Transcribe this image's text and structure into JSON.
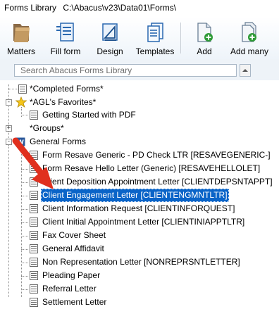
{
  "window": {
    "title": "Forms Library",
    "path": "C:\\Abacus\\v23\\Data01\\Forms\\"
  },
  "toolbar": {
    "matters": "Matters",
    "fill_form": "Fill form",
    "design": "Design",
    "templates": "Templates",
    "add": "Add",
    "add_many": "Add many"
  },
  "search": {
    "placeholder": "Search Abacus Forms Library"
  },
  "tree": {
    "completed_forms": "*Completed Forms*",
    "favorites": "*AGL's Favorites*",
    "getting_started": "Getting Started with PDF",
    "groups": "*Groups*",
    "general_forms": "General Forms",
    "items": [
      "Form Resave Generic - PD Check LTR [RESAVEGENERIC-]",
      "Form Resave Hello Letter (Generic) [RESAVEHELLOLET]",
      "Client Deposition Appointment Letter [CLIENTDEPSNTAPPT]",
      "Client Engagement Letter [CLIENTENGMNTLTR]",
      "Client Information Request [CLIENTINFORQUEST]",
      "Client Initial Appointment Letter [CLIENTINIAPPTLTR]",
      "Fax Cover Sheet",
      "General Affidavit",
      "Non Representation Letter [NONREPRSNTLETTER]",
      "Pleading Paper",
      "Referral Letter",
      "Settlement Letter"
    ],
    "selected_index": 3
  },
  "colors": {
    "selection": "#0a64c8",
    "arrow": "#e0301e",
    "star": "#f5c518"
  }
}
